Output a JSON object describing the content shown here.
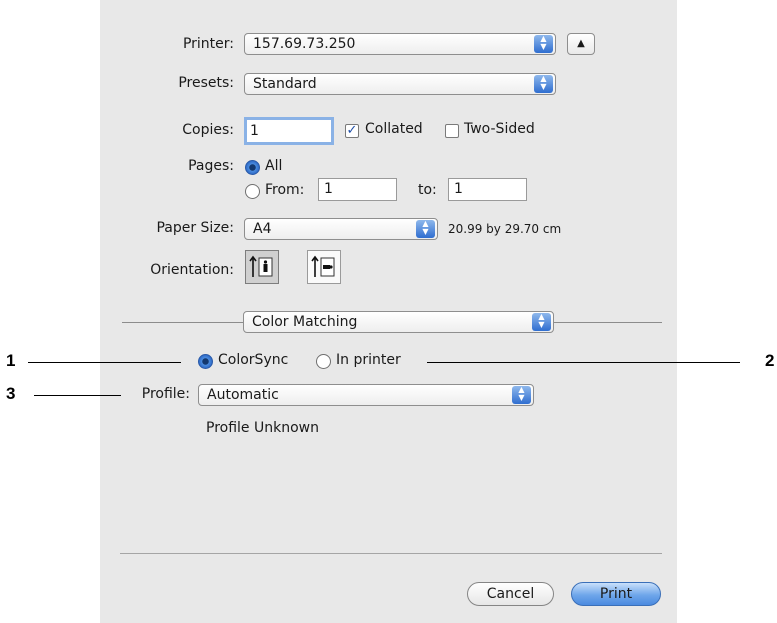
{
  "printer": {
    "label": "Printer:",
    "value": "157.69.73.250"
  },
  "presets": {
    "label": "Presets:",
    "value": "Standard"
  },
  "copies": {
    "label": "Copies:",
    "value": "1",
    "collated_label": "Collated",
    "collated_checked": true,
    "two_sided_label": "Two-Sided",
    "two_sided_checked": false
  },
  "pages": {
    "label": "Pages:",
    "all_label": "All",
    "from_label": "From:",
    "from_value": "1",
    "to_label": "to:",
    "to_value": "1",
    "selected": "all"
  },
  "paper_size": {
    "label": "Paper Size:",
    "value": "A4",
    "dimensions": "20.99 by 29.70 cm"
  },
  "orientation": {
    "label": "Orientation:",
    "options": [
      "portrait",
      "landscape"
    ],
    "selected": "portrait"
  },
  "section": {
    "value": "Color Matching"
  },
  "color_matching": {
    "colorsync_label": "ColorSync",
    "in_printer_label": "In printer",
    "selected": "colorsync"
  },
  "profile": {
    "label": "Profile:",
    "value": "Automatic",
    "status": "Profile Unknown"
  },
  "buttons": {
    "cancel": "Cancel",
    "print": "Print"
  },
  "callouts": {
    "one": "1",
    "two": "2",
    "three": "3"
  }
}
